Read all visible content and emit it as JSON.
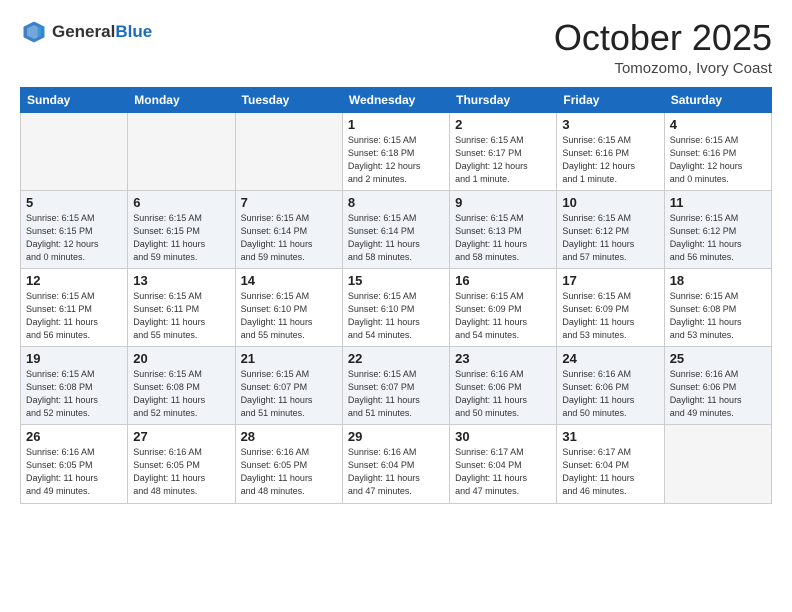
{
  "header": {
    "logo_general": "General",
    "logo_blue": "Blue",
    "month": "October 2025",
    "location": "Tomozomo, Ivory Coast"
  },
  "weekdays": [
    "Sunday",
    "Monday",
    "Tuesday",
    "Wednesday",
    "Thursday",
    "Friday",
    "Saturday"
  ],
  "weeks": [
    [
      {
        "day": "",
        "info": ""
      },
      {
        "day": "",
        "info": ""
      },
      {
        "day": "",
        "info": ""
      },
      {
        "day": "1",
        "info": "Sunrise: 6:15 AM\nSunset: 6:18 PM\nDaylight: 12 hours\nand 2 minutes."
      },
      {
        "day": "2",
        "info": "Sunrise: 6:15 AM\nSunset: 6:17 PM\nDaylight: 12 hours\nand 1 minute."
      },
      {
        "day": "3",
        "info": "Sunrise: 6:15 AM\nSunset: 6:16 PM\nDaylight: 12 hours\nand 1 minute."
      },
      {
        "day": "4",
        "info": "Sunrise: 6:15 AM\nSunset: 6:16 PM\nDaylight: 12 hours\nand 0 minutes."
      }
    ],
    [
      {
        "day": "5",
        "info": "Sunrise: 6:15 AM\nSunset: 6:15 PM\nDaylight: 12 hours\nand 0 minutes."
      },
      {
        "day": "6",
        "info": "Sunrise: 6:15 AM\nSunset: 6:15 PM\nDaylight: 11 hours\nand 59 minutes."
      },
      {
        "day": "7",
        "info": "Sunrise: 6:15 AM\nSunset: 6:14 PM\nDaylight: 11 hours\nand 59 minutes."
      },
      {
        "day": "8",
        "info": "Sunrise: 6:15 AM\nSunset: 6:14 PM\nDaylight: 11 hours\nand 58 minutes."
      },
      {
        "day": "9",
        "info": "Sunrise: 6:15 AM\nSunset: 6:13 PM\nDaylight: 11 hours\nand 58 minutes."
      },
      {
        "day": "10",
        "info": "Sunrise: 6:15 AM\nSunset: 6:12 PM\nDaylight: 11 hours\nand 57 minutes."
      },
      {
        "day": "11",
        "info": "Sunrise: 6:15 AM\nSunset: 6:12 PM\nDaylight: 11 hours\nand 56 minutes."
      }
    ],
    [
      {
        "day": "12",
        "info": "Sunrise: 6:15 AM\nSunset: 6:11 PM\nDaylight: 11 hours\nand 56 minutes."
      },
      {
        "day": "13",
        "info": "Sunrise: 6:15 AM\nSunset: 6:11 PM\nDaylight: 11 hours\nand 55 minutes."
      },
      {
        "day": "14",
        "info": "Sunrise: 6:15 AM\nSunset: 6:10 PM\nDaylight: 11 hours\nand 55 minutes."
      },
      {
        "day": "15",
        "info": "Sunrise: 6:15 AM\nSunset: 6:10 PM\nDaylight: 11 hours\nand 54 minutes."
      },
      {
        "day": "16",
        "info": "Sunrise: 6:15 AM\nSunset: 6:09 PM\nDaylight: 11 hours\nand 54 minutes."
      },
      {
        "day": "17",
        "info": "Sunrise: 6:15 AM\nSunset: 6:09 PM\nDaylight: 11 hours\nand 53 minutes."
      },
      {
        "day": "18",
        "info": "Sunrise: 6:15 AM\nSunset: 6:08 PM\nDaylight: 11 hours\nand 53 minutes."
      }
    ],
    [
      {
        "day": "19",
        "info": "Sunrise: 6:15 AM\nSunset: 6:08 PM\nDaylight: 11 hours\nand 52 minutes."
      },
      {
        "day": "20",
        "info": "Sunrise: 6:15 AM\nSunset: 6:08 PM\nDaylight: 11 hours\nand 52 minutes."
      },
      {
        "day": "21",
        "info": "Sunrise: 6:15 AM\nSunset: 6:07 PM\nDaylight: 11 hours\nand 51 minutes."
      },
      {
        "day": "22",
        "info": "Sunrise: 6:15 AM\nSunset: 6:07 PM\nDaylight: 11 hours\nand 51 minutes."
      },
      {
        "day": "23",
        "info": "Sunrise: 6:16 AM\nSunset: 6:06 PM\nDaylight: 11 hours\nand 50 minutes."
      },
      {
        "day": "24",
        "info": "Sunrise: 6:16 AM\nSunset: 6:06 PM\nDaylight: 11 hours\nand 50 minutes."
      },
      {
        "day": "25",
        "info": "Sunrise: 6:16 AM\nSunset: 6:06 PM\nDaylight: 11 hours\nand 49 minutes."
      }
    ],
    [
      {
        "day": "26",
        "info": "Sunrise: 6:16 AM\nSunset: 6:05 PM\nDaylight: 11 hours\nand 49 minutes."
      },
      {
        "day": "27",
        "info": "Sunrise: 6:16 AM\nSunset: 6:05 PM\nDaylight: 11 hours\nand 48 minutes."
      },
      {
        "day": "28",
        "info": "Sunrise: 6:16 AM\nSunset: 6:05 PM\nDaylight: 11 hours\nand 48 minutes."
      },
      {
        "day": "29",
        "info": "Sunrise: 6:16 AM\nSunset: 6:04 PM\nDaylight: 11 hours\nand 47 minutes."
      },
      {
        "day": "30",
        "info": "Sunrise: 6:17 AM\nSunset: 6:04 PM\nDaylight: 11 hours\nand 47 minutes."
      },
      {
        "day": "31",
        "info": "Sunrise: 6:17 AM\nSunset: 6:04 PM\nDaylight: 11 hours\nand 46 minutes."
      },
      {
        "day": "",
        "info": ""
      }
    ]
  ]
}
